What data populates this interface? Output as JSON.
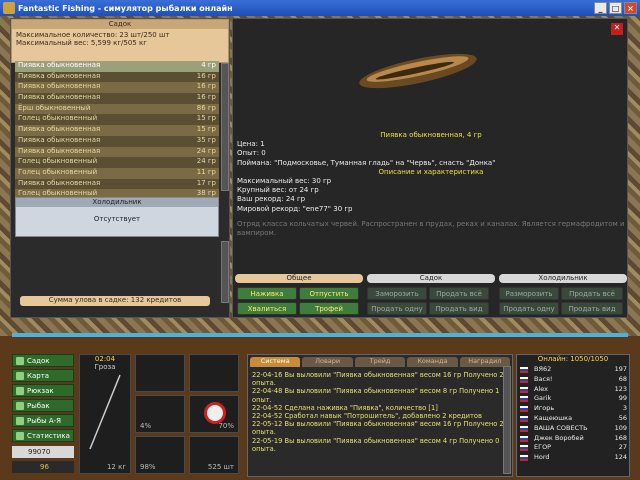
{
  "window": {
    "title": "Fantastic Fishing - симулятор рыбалки онлайн"
  },
  "sadok": {
    "header": "Садок",
    "max_count": "Максимальное количество: 23 шт/250 шт",
    "max_weight": "Максимальный вес: 5,599 кг/505 кг"
  },
  "fish_list": [
    {
      "name": "Пиявка обыкновенная",
      "weight": "4 гр"
    },
    {
      "name": "Пиявка обыкновенная",
      "weight": "16 гр"
    },
    {
      "name": "Пиявка обыкновенная",
      "weight": "16 гр"
    },
    {
      "name": "Пиявка обыкновенная",
      "weight": "16 гр"
    },
    {
      "name": "Ёрш обыкновенный",
      "weight": "86 гр"
    },
    {
      "name": "Голец обыкновенный",
      "weight": "15 гр"
    },
    {
      "name": "Пиявка обыкновенная",
      "weight": "15 гр"
    },
    {
      "name": "Пиявка обыкновенная",
      "weight": "35 гр"
    },
    {
      "name": "Пиявка обыкновенная",
      "weight": "24 гр"
    },
    {
      "name": "Голец обыкновенный",
      "weight": "24 гр"
    },
    {
      "name": "Голец обыкновенный",
      "weight": "11 гр"
    },
    {
      "name": "Пиявка обыкновенная",
      "weight": "17 гр"
    },
    {
      "name": "Голец обыкновенный",
      "weight": "38 гр"
    }
  ],
  "fridge": {
    "header": "Холодильник",
    "status": "Отсутствует"
  },
  "sum_label": "Сумма улова в садке: 132 кредитов",
  "details": {
    "title": "Пиявка обыкновенная, 4 гр",
    "price": "Цена: 1",
    "exp": "Опыт: 0",
    "caught": "Поймана: \"Подмосковье, Туманная гладь\" на \"Червь\", снасть \"Донка\"",
    "section": "Описание и характеристика",
    "max_weight": "Максимальный вес: 30 гр",
    "big_weight": "Крупный вес: от 24 гр",
    "your_record": "Ваш рекорд: 24 гр",
    "world_record": "Мировой рекорд: \"ene77\" 30 гр",
    "description": "Отряд класса кольчатых червей. Распространен в прудах, реках и каналах. Является гермафродитом и вампиром."
  },
  "tabs": [
    "Общее",
    "Садок",
    "Холодильник"
  ],
  "buttons": {
    "bait": "Наживка",
    "release": "Отпустить",
    "boast": "Хвалиться",
    "trophy": "Трофей",
    "freeze": "Заморозить",
    "sell_all": "Продать всё",
    "sell_one": "Продать одну",
    "sell_kind": "Продать вид",
    "unfreeze": "Разморозить",
    "sell_all2": "Продать всё",
    "sell_one2": "Продать одну",
    "sell_kind2": "Продать вид"
  },
  "side_menu": [
    "Садок",
    "Карта",
    "Рюкзак",
    "Рыбак",
    "Рыбы А-Я",
    "Статистика"
  ],
  "money": "99070",
  "money2": "96",
  "clock": {
    "time": "02:04",
    "weather": "Гроза"
  },
  "gear": {
    "line_weight": "12 кг",
    "pct1": "4%",
    "pct2": "98%",
    "pct3": "70%",
    "bait_weight": "525 шт"
  },
  "chat_tabs": [
    "Система",
    "Ловари",
    "Трейд",
    "Команда",
    "Наградил"
  ],
  "messages": [
    "22-04-16 Вы выловили \"Пиявка обыкновенная\" весом 16 гр Получено 2 опыта.",
    "22-04-48 Вы выловили \"Пиявка обыкновенная\" весом 8 гр Получено 1 опыт.",
    "22-04-52 Сделана наживка \"Пиявка\", количество [1]",
    "22-04-52 Сработал навык \"Потрошитель\", добавлено 2 кредитов",
    "22-05-12 Вы выловили \"Пиявка обыкновенная\" весом 16 гр Получено 2 опыта.",
    "22-05-19 Вы выловили \"Пиявка обыкновенная\" весом 4 гр Получено 0 опыта."
  ],
  "online": {
    "header": "Онлайн: 1050/1050",
    "players": [
      {
        "name": "ВЯ62",
        "lvl": "197"
      },
      {
        "name": "Вася!",
        "lvl": "68"
      },
      {
        "name": "Alex",
        "lvl": "123"
      },
      {
        "name": "Garik",
        "lvl": "99"
      },
      {
        "name": "Игорь",
        "lvl": "3"
      },
      {
        "name": "Кащеюшка",
        "lvl": "56"
      },
      {
        "name": "ВАША СОВЕСТЬ",
        "lvl": "109"
      },
      {
        "name": "Джек Воробей",
        "lvl": "168"
      },
      {
        "name": "ЕГОР",
        "lvl": "27"
      },
      {
        "name": "Hord",
        "lvl": "124"
      }
    ]
  }
}
